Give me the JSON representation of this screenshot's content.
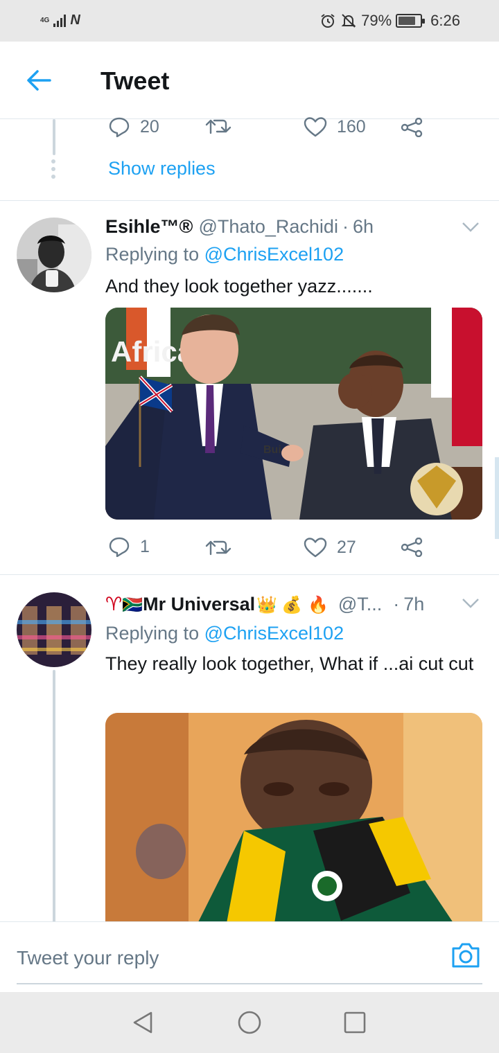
{
  "status_bar": {
    "network": "4G",
    "carrier_glyph": "N",
    "battery_percent": "79%",
    "battery_level": 0.79,
    "time": "6:26",
    "icons": [
      "alarm-icon",
      "mute-icon",
      "battery-icon"
    ]
  },
  "header": {
    "title": "Tweet",
    "back_icon": "arrow-left-icon"
  },
  "previous_tweet": {
    "reply_count": "20",
    "retweet_count": "",
    "like_count": "160",
    "show_replies_label": "Show replies"
  },
  "tweets": [
    {
      "name": "Esihle™®",
      "handle": "@Thato_Rachidi",
      "time": "6h",
      "replying_prefix": "Replying to",
      "replying_to": "@ChrisExcel102",
      "text": "And they look together yazz.......",
      "media_caption": "Africa ar",
      "media_podium_text": "Bui",
      "reply_count": "1",
      "retweet_count": "",
      "like_count": "27"
    },
    {
      "name": "Mr Universal",
      "name_emoji": [
        "♈",
        "🇿🇦",
        "👑",
        "💰",
        "🔥"
      ],
      "handle": "@T...",
      "time": "7h",
      "replying_prefix": "Replying to",
      "replying_to": "@ChrisExcel102",
      "text": "They really look together, What if ...ai cut cut"
    }
  ],
  "reply_bar": {
    "placeholder": "Tweet your reply",
    "camera_icon": "camera-icon"
  },
  "nav_bar": {
    "buttons": [
      "back-triangle-icon",
      "home-circle-icon",
      "recents-square-icon"
    ]
  },
  "colors": {
    "accent": "#1da1f2",
    "secondary_text": "#657786",
    "divider": "#e1e8ed"
  }
}
